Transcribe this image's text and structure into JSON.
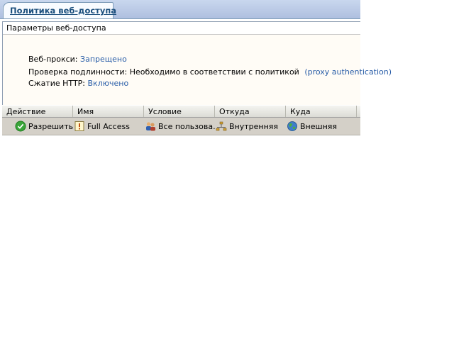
{
  "tab": {
    "label": "Политика веб-доступа"
  },
  "panel": {
    "title": "Параметры веб-доступа",
    "web_proxy": {
      "label": "Веб-прокси:",
      "value": "Запрещено"
    },
    "auth": {
      "label": "Проверка подлинности:",
      "value": "Необходимо в соответствии с политикой",
      "extra": "(proxy authentication)"
    },
    "compression": {
      "label": "Сжатие HTTP:",
      "value": "Включено"
    }
  },
  "grid": {
    "columns": [
      "Действие",
      "Имя",
      "Условие",
      "Откуда",
      "Куда"
    ],
    "rows": [
      {
        "action": "Разрешить",
        "action_icon": "allow-check-icon",
        "name": "Full Access",
        "name_icon": "rule-icon",
        "condition": "Все пользова...",
        "condition_icon": "users-icon",
        "source": "Внутренняя",
        "source_icon": "network-icon",
        "destination": "Внешняя",
        "destination_icon": "globe-icon"
      }
    ]
  },
  "colors": {
    "link": "#2a5ea8",
    "tab_text": "#1c4f7d",
    "panel_bg": "#fffcf6",
    "row_bg": "#d4d0c8"
  }
}
